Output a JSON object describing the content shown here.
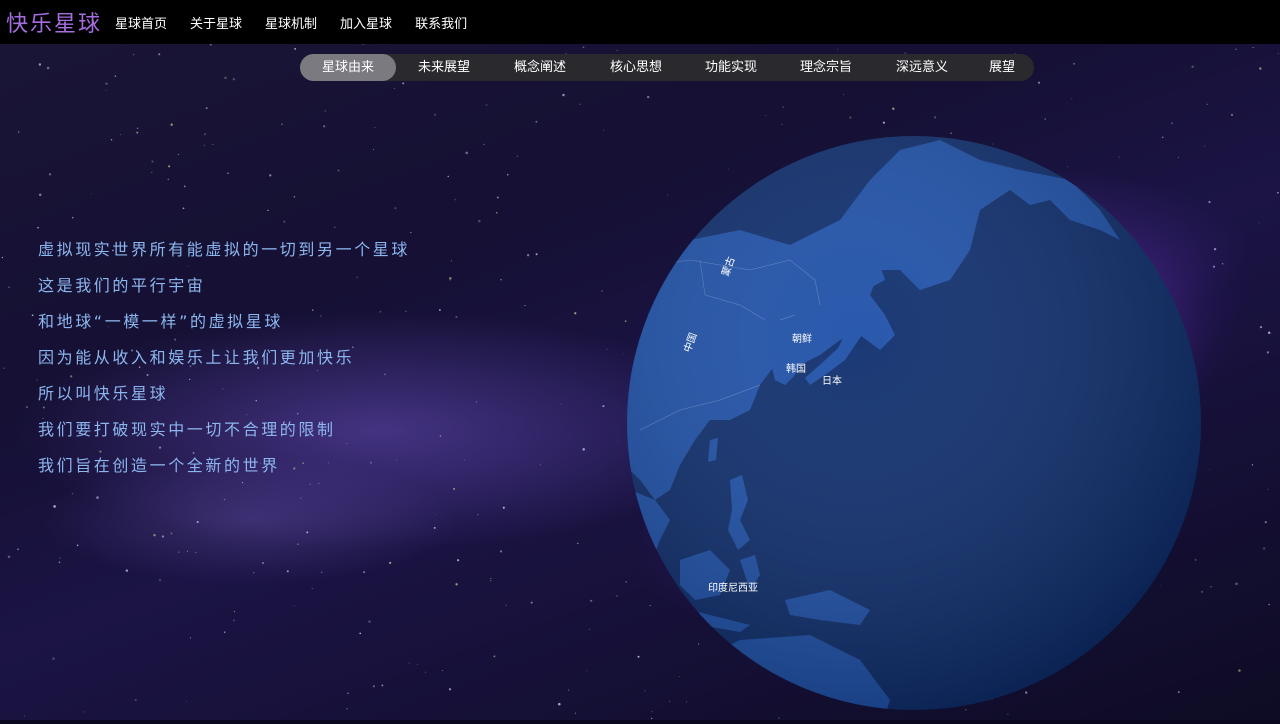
{
  "brand": {
    "logo": "快乐星球"
  },
  "nav": [
    {
      "label": "星球首页"
    },
    {
      "label": "关于星球"
    },
    {
      "label": "星球机制"
    },
    {
      "label": "加入星球"
    },
    {
      "label": "联系我们"
    }
  ],
  "tabs": [
    {
      "label": "星球由来",
      "active": true
    },
    {
      "label": "未来展望",
      "active": false
    },
    {
      "label": "概念阐述",
      "active": false
    },
    {
      "label": "核心思想",
      "active": false
    },
    {
      "label": "功能实现",
      "active": false
    },
    {
      "label": "理念宗旨",
      "active": false
    },
    {
      "label": "深远意义",
      "active": false
    },
    {
      "label": "展望",
      "active": false
    }
  ],
  "intro_lines": [
    "虚拟现实世界所有能虚拟的一切到另一个星球",
    "这是我们的平行宇宙",
    "和地球“一模一样”的虚拟星球",
    "因为能从收入和娱乐上让我们更加快乐",
    "所以叫快乐星球",
    "我们要打破现实中一切不合理的限制",
    "我们旨在创造一个全新的世界"
  ],
  "globe": {
    "labels": {
      "mongolia": "蒙古",
      "china": "中国",
      "north_korea": "朝鲜",
      "south_korea": "韩国",
      "japan": "日本",
      "indonesia": "印度尼西亚"
    },
    "colors": {
      "ocean": "#0c2c6c",
      "land": "#1c4fa8",
      "border": "#5b7fc4"
    }
  },
  "colors": {
    "brand": "#a56de0",
    "intro_text": "#8cb6ee",
    "tab_active": "#7a7a80",
    "tab_bar": "#2a2a2e"
  }
}
